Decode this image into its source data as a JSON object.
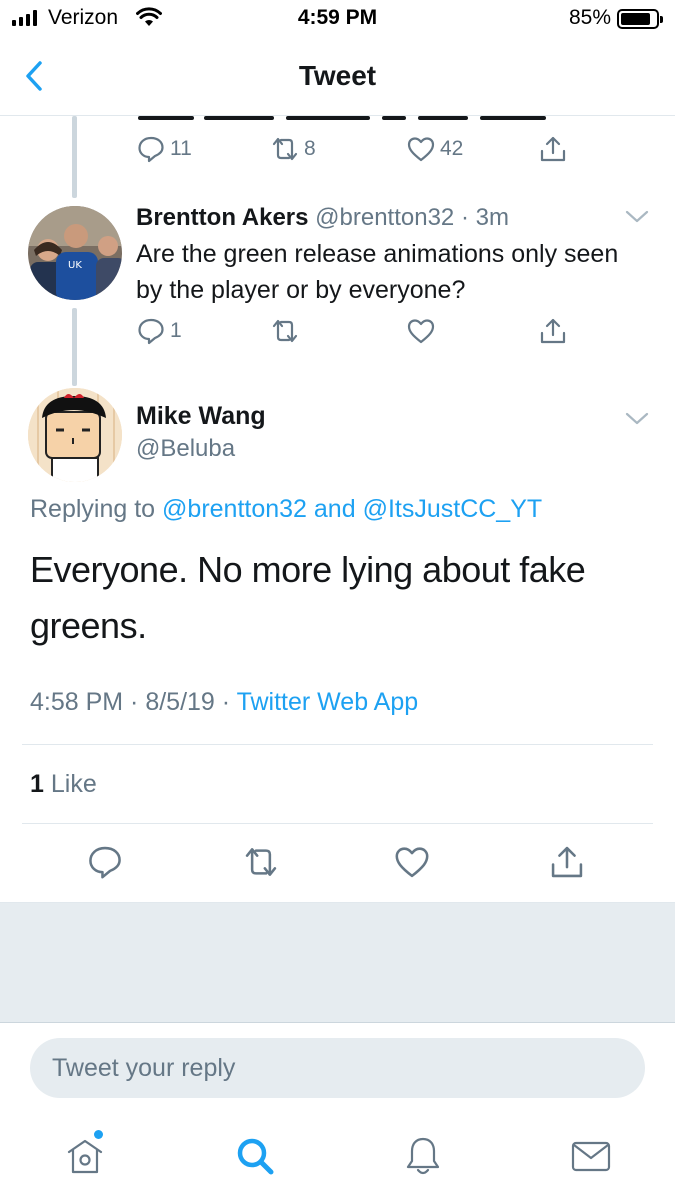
{
  "status_bar": {
    "carrier": "Verizon",
    "time": "4:59 PM",
    "battery": "85%"
  },
  "nav": {
    "title": "Tweet"
  },
  "parent_tweet_cut": {
    "reply_count": "11",
    "retweet_count": "8",
    "like_count": "42"
  },
  "reply_tweet": {
    "name": "Brentton Akers",
    "handle": "@brentton32",
    "time": "· 3m",
    "text": "Are the green release animations only seen by the player or by everyone?",
    "reply_count": "1"
  },
  "main_tweet": {
    "name": "Mike Wang",
    "handle": "@Beluba",
    "replying_prefix": "Replying to",
    "replying_user1": "@brentton32",
    "replying_and": "and",
    "replying_user2": "@ItsJustCC_YT",
    "text": "Everyone. No more lying about fake greens.",
    "time": "4:58 PM · 8/5/19 · ",
    "source": "Twitter Web App",
    "like_count": "1",
    "like_label": "Like"
  },
  "reply_box": {
    "placeholder": "Tweet your reply"
  },
  "colors": {
    "accent": "#1da1f2",
    "secondary_text": "#657786",
    "divider": "#e1e8ed"
  },
  "tab_bar": {
    "icons": [
      "home-icon",
      "search-icon",
      "notifications-icon",
      "messages-icon"
    ]
  }
}
